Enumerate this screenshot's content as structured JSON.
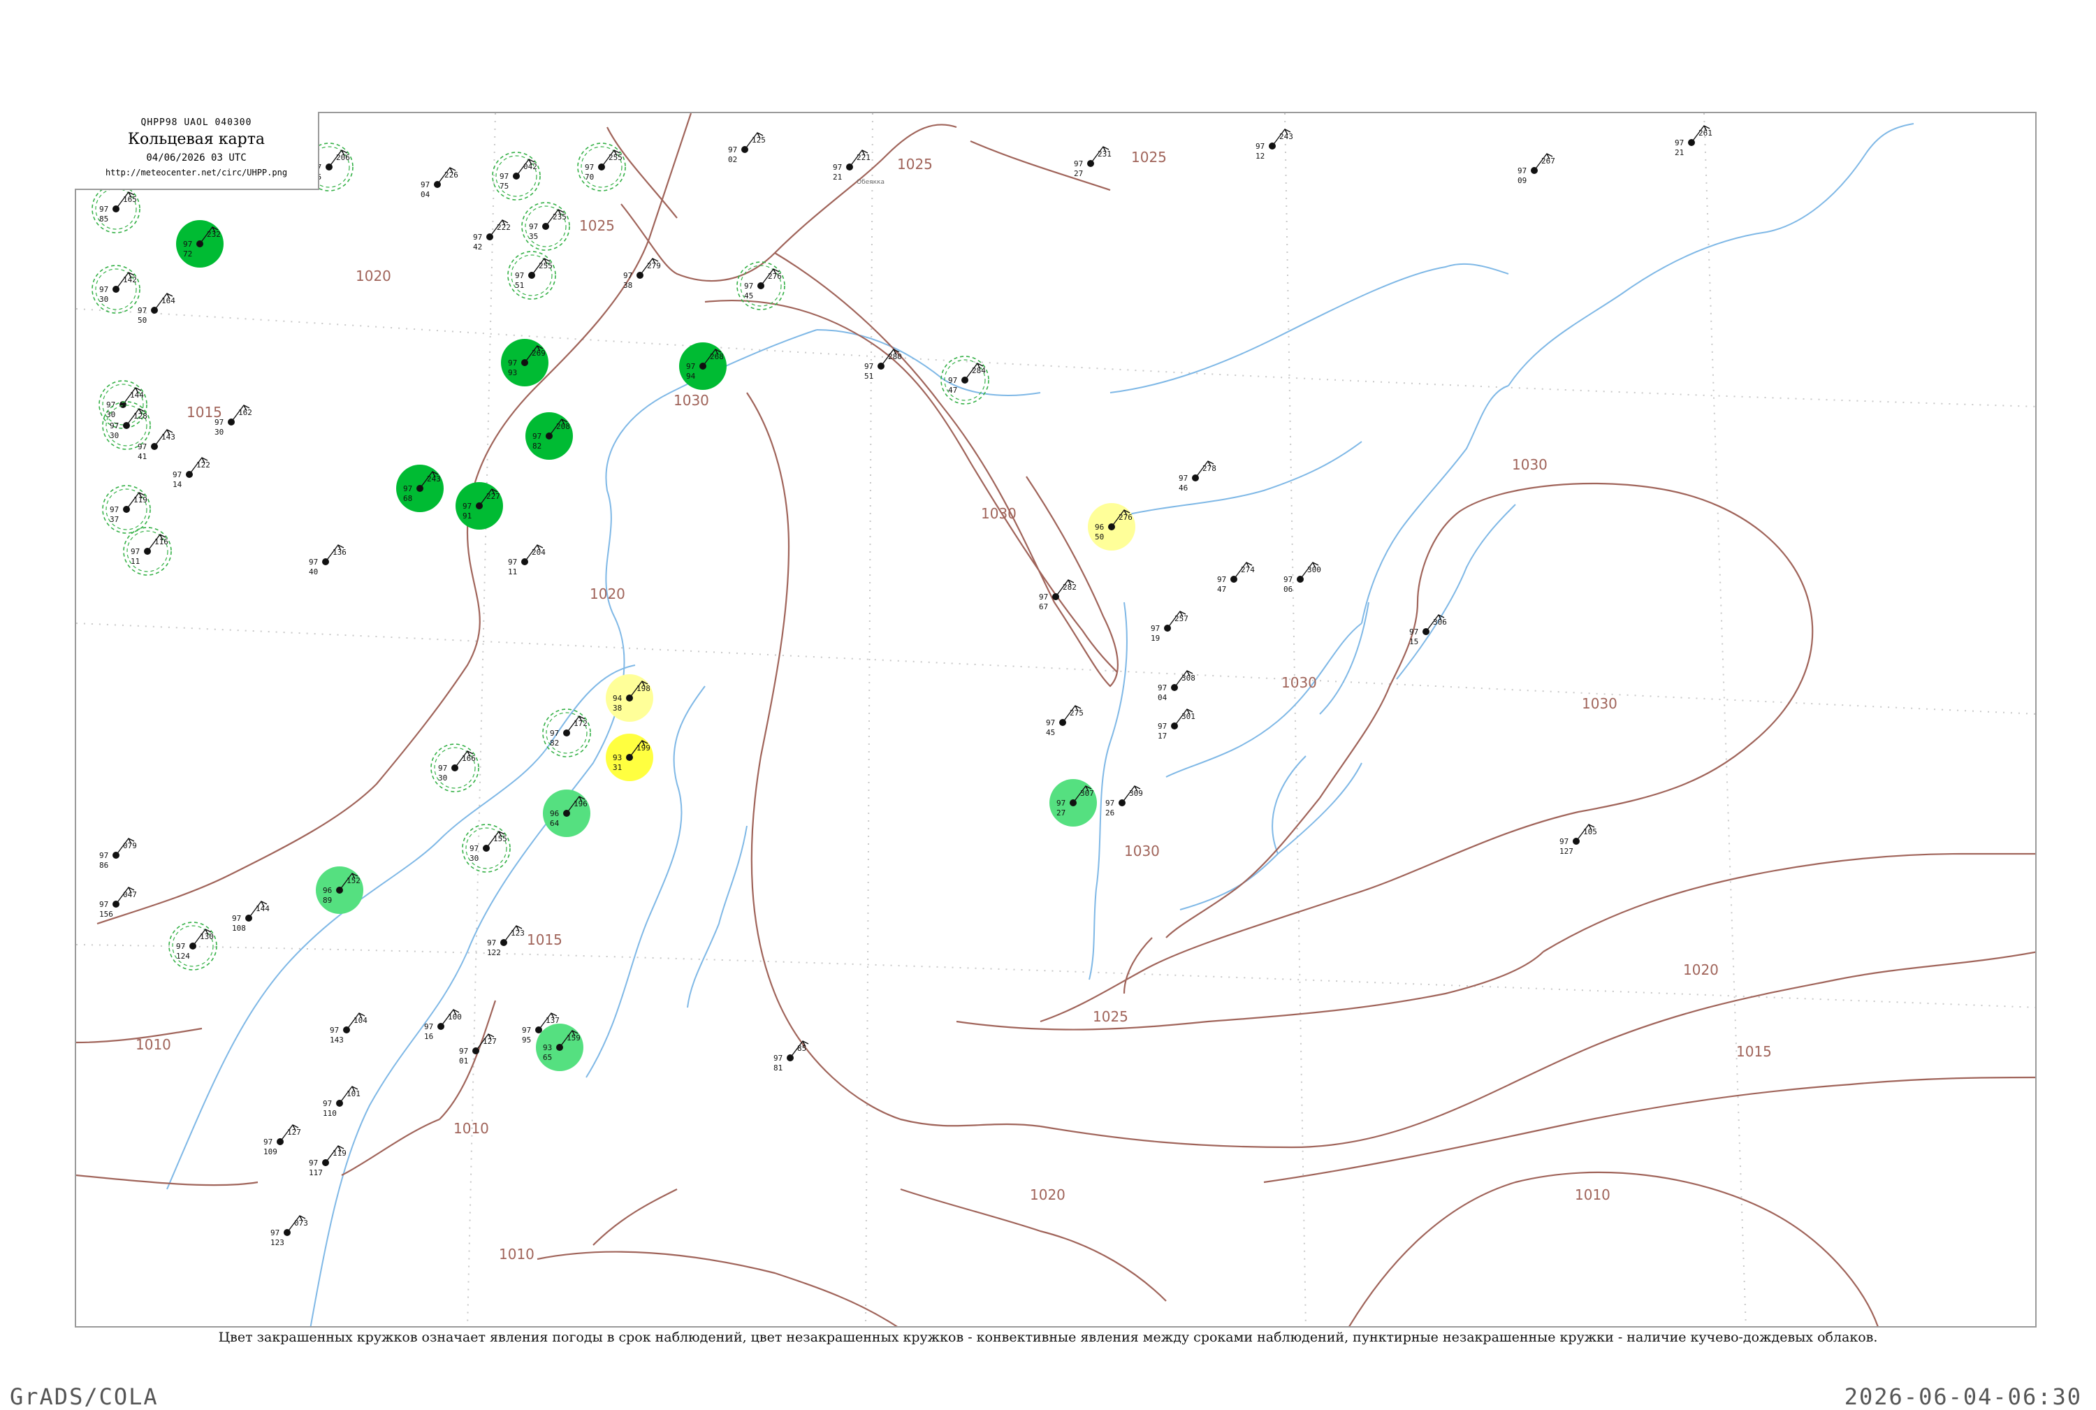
{
  "header": {
    "code": "QHPP98  UAOL  040300",
    "title": "Кольцевая карта",
    "datetime": "04/06/2026 03 UTC",
    "url": "http://meteocenter.net/circ/UHPP.png"
  },
  "caption": "Цвет закрашенных кружков означает явления погоды в срок наблюдений, цвет незакрашенных кружков - конвективные явления между сроками наблюдений, пунктирные незакрашенные кружки - наличие кучево-дождевых облаков.",
  "footer": {
    "left": "GrADS/COLA",
    "right": "2026-06-04-06:30"
  },
  "colors": {
    "isobar": "#a0645a",
    "river": "#7fb8e6",
    "cb_ring": "#33b045",
    "rain_fill": "#00bb33",
    "shower_fill": "#55e080",
    "thunder_fill": "#ffff40",
    "fog_fill": "#ffff99"
  },
  "isobar_labels": [
    "1010",
    "1015",
    "1020",
    "1025",
    "1030"
  ],
  "stations": [
    {
      "id": "s01",
      "p": "165",
      "t": "97",
      "td": "85",
      "name": "",
      "mark": "cb"
    },
    {
      "id": "s02",
      "p": "142",
      "t": "97",
      "td": "30",
      "name": "",
      "mark": "cb"
    },
    {
      "id": "s03",
      "p": "206",
      "t": "97",
      "td": "95",
      "name": "",
      "mark": "cb"
    },
    {
      "id": "s04",
      "p": "226",
      "t": "97",
      "td": "04",
      "name": "",
      "mark": "none"
    },
    {
      "id": "s05",
      "p": "042",
      "t": "97",
      "td": "75",
      "name": "",
      "mark": "cb"
    },
    {
      "id": "s06",
      "p": "255",
      "t": "97",
      "td": "70",
      "name": "",
      "mark": "cb"
    },
    {
      "id": "s07",
      "p": "125",
      "t": "97",
      "td": "02",
      "name": "",
      "mark": "none"
    },
    {
      "id": "s08",
      "p": "221",
      "t": "97",
      "td": "21",
      "name": "Обеякка",
      "mark": "none"
    },
    {
      "id": "s09",
      "p": "231",
      "t": "97",
      "td": "27",
      "name": "",
      "mark": "none"
    },
    {
      "id": "s10",
      "p": "243",
      "t": "97",
      "td": "12",
      "name": "",
      "mark": "none"
    },
    {
      "id": "s11",
      "p": "261",
      "t": "97",
      "td": "21",
      "name": "",
      "mark": "none"
    },
    {
      "id": "s12",
      "p": "267",
      "t": "97",
      "td": "09",
      "name": "",
      "mark": "none"
    },
    {
      "id": "s13",
      "p": "232",
      "t": "97",
      "td": "72",
      "name": "",
      "mark": "rain"
    },
    {
      "id": "s14",
      "p": "235",
      "t": "97",
      "td": "35",
      "name": "",
      "mark": "cb"
    },
    {
      "id": "s15",
      "p": "222",
      "t": "97",
      "td": "42",
      "name": "",
      "mark": "none"
    },
    {
      "id": "s16",
      "p": "255",
      "t": "97",
      "td": "51",
      "name": "",
      "mark": "cb"
    },
    {
      "id": "s17",
      "p": "279",
      "t": "97",
      "td": "38",
      "name": "",
      "mark": "none"
    },
    {
      "id": "s18",
      "p": "276",
      "t": "97",
      "td": "45",
      "name": "",
      "mark": "cb"
    },
    {
      "id": "s19",
      "p": "164",
      "t": "97",
      "td": "50",
      "name": "",
      "mark": "none"
    },
    {
      "id": "s20",
      "p": "144",
      "t": "97",
      "td": "30",
      "name": "",
      "mark": "cb"
    },
    {
      "id": "s21",
      "p": "269",
      "t": "97",
      "td": "93",
      "name": "",
      "mark": "rain"
    },
    {
      "id": "s22",
      "p": "268",
      "t": "97",
      "td": "94",
      "name": "",
      "mark": "rain"
    },
    {
      "id": "s23",
      "p": "280",
      "t": "97",
      "td": "51",
      "name": "",
      "mark": "none"
    },
    {
      "id": "s24",
      "p": "284",
      "t": "97",
      "td": "47",
      "name": "",
      "mark": "cb"
    },
    {
      "id": "s25",
      "p": "162",
      "t": "97",
      "td": "30",
      "name": "",
      "mark": "none"
    },
    {
      "id": "s26",
      "p": "128",
      "t": "97",
      "td": "30",
      "name": "",
      "mark": "cb"
    },
    {
      "id": "s27",
      "p": "143",
      "t": "97",
      "td": "41",
      "name": "",
      "mark": "none"
    },
    {
      "id": "s28",
      "p": "122",
      "t": "97",
      "td": "14",
      "name": "",
      "mark": "none"
    },
    {
      "id": "s29",
      "p": "208",
      "t": "97",
      "td": "82",
      "name": "",
      "mark": "rain"
    },
    {
      "id": "s30",
      "p": "243",
      "t": "97",
      "td": "68",
      "name": "",
      "mark": "rain"
    },
    {
      "id": "s31",
      "p": "227",
      "t": "97",
      "td": "91",
      "name": "",
      "mark": "rain"
    },
    {
      "id": "s32",
      "p": "119",
      "t": "97",
      "td": "37",
      "name": "",
      "mark": "cb"
    },
    {
      "id": "s33",
      "p": "116",
      "t": "97",
      "td": "11",
      "name": "",
      "mark": "cb"
    },
    {
      "id": "s34",
      "p": "136",
      "t": "97",
      "td": "40",
      "name": "",
      "mark": "none"
    },
    {
      "id": "s35",
      "p": "204",
      "t": "97",
      "td": "11",
      "name": "",
      "mark": "none"
    },
    {
      "id": "s36",
      "p": "278",
      "t": "97",
      "td": "46",
      "name": "",
      "mark": "none"
    },
    {
      "id": "s37",
      "p": "276",
      "t": "96",
      "td": "50",
      "name": "",
      "mark": "fog"
    },
    {
      "id": "s38",
      "p": "282",
      "t": "97",
      "td": "67",
      "name": "",
      "mark": "none"
    },
    {
      "id": "s39",
      "p": "274",
      "t": "97",
      "td": "47",
      "name": "",
      "mark": "none"
    },
    {
      "id": "s40",
      "p": "300",
      "t": "97",
      "td": "06",
      "name": "",
      "mark": "none"
    },
    {
      "id": "s41",
      "p": "306",
      "t": "97",
      "td": "15",
      "name": "",
      "mark": "none"
    },
    {
      "id": "s42",
      "p": "257",
      "t": "97",
      "td": "19",
      "name": "",
      "mark": "none"
    },
    {
      "id": "s43",
      "p": "308",
      "t": "97",
      "td": "04",
      "name": "",
      "mark": "none"
    },
    {
      "id": "s44",
      "p": "198",
      "t": "94",
      "td": "38",
      "name": "",
      "mark": "fog"
    },
    {
      "id": "s45",
      "p": "199",
      "t": "93",
      "td": "31",
      "name": "",
      "mark": "thunder"
    },
    {
      "id": "s46",
      "p": "196",
      "t": "96",
      "td": "64",
      "name": "",
      "mark": "shower"
    },
    {
      "id": "s47",
      "p": "172",
      "t": "97",
      "td": "82",
      "name": "",
      "mark": "cb"
    },
    {
      "id": "s48",
      "p": "275",
      "t": "97",
      "td": "45",
      "name": "",
      "mark": "none"
    },
    {
      "id": "s49",
      "p": "301",
      "t": "97",
      "td": "17",
      "name": "",
      "mark": "none"
    },
    {
      "id": "s50",
      "p": "307",
      "t": "97",
      "td": "27",
      "name": "",
      "mark": "shower"
    },
    {
      "id": "s51",
      "p": "309",
      "t": "97",
      "td": "26",
      "name": "",
      "mark": "none"
    },
    {
      "id": "s52",
      "p": "105",
      "t": "97",
      "td": "127",
      "name": "",
      "mark": "none"
    },
    {
      "id": "s53",
      "p": "166",
      "t": "97",
      "td": "30",
      "name": "",
      "mark": "cb"
    },
    {
      "id": "s54",
      "p": "155",
      "t": "97",
      "td": "30",
      "name": "",
      "mark": "cb"
    },
    {
      "id": "s55",
      "p": "152",
      "t": "96",
      "td": "89",
      "name": "",
      "mark": "shower"
    },
    {
      "id": "s56",
      "p": "144",
      "t": "97",
      "td": "108",
      "name": "",
      "mark": "none"
    },
    {
      "id": "s57",
      "p": "130",
      "t": "97",
      "td": "124",
      "name": "",
      "mark": "cb"
    },
    {
      "id": "s58",
      "p": "047",
      "t": "97",
      "td": "156",
      "name": "",
      "mark": "none"
    },
    {
      "id": "s59",
      "p": "079",
      "t": "97",
      "td": "86",
      "name": "",
      "mark": "none"
    },
    {
      "id": "s60",
      "p": "123",
      "t": "97",
      "td": "122",
      "name": "",
      "mark": "none"
    },
    {
      "id": "s61",
      "p": "159",
      "t": "93",
      "td": "65",
      "name": "",
      "mark": "shower"
    },
    {
      "id": "s62",
      "p": "137",
      "t": "97",
      "td": "95",
      "name": "",
      "mark": "none"
    },
    {
      "id": "s63",
      "p": "127",
      "t": "97",
      "td": "01",
      "name": "",
      "mark": "none"
    },
    {
      "id": "s64",
      "p": "100",
      "t": "97",
      "td": "16",
      "name": "",
      "mark": "none"
    },
    {
      "id": "s65",
      "p": "104",
      "t": "97",
      "td": "143",
      "name": "",
      "mark": "none"
    },
    {
      "id": "s66",
      "p": "101",
      "t": "97",
      "td": "110",
      "name": "",
      "mark": "none"
    },
    {
      "id": "s67",
      "p": "119",
      "t": "97",
      "td": "117",
      "name": "",
      "mark": "none"
    },
    {
      "id": "s68",
      "p": "073",
      "t": "97",
      "td": "123",
      "name": "",
      "mark": "none"
    },
    {
      "id": "s69",
      "p": "127",
      "t": "97",
      "td": "109",
      "name": "",
      "mark": "none"
    },
    {
      "id": "s70",
      "p": "85",
      "t": "97",
      "td": "81",
      "name": "",
      "mark": "none"
    }
  ]
}
